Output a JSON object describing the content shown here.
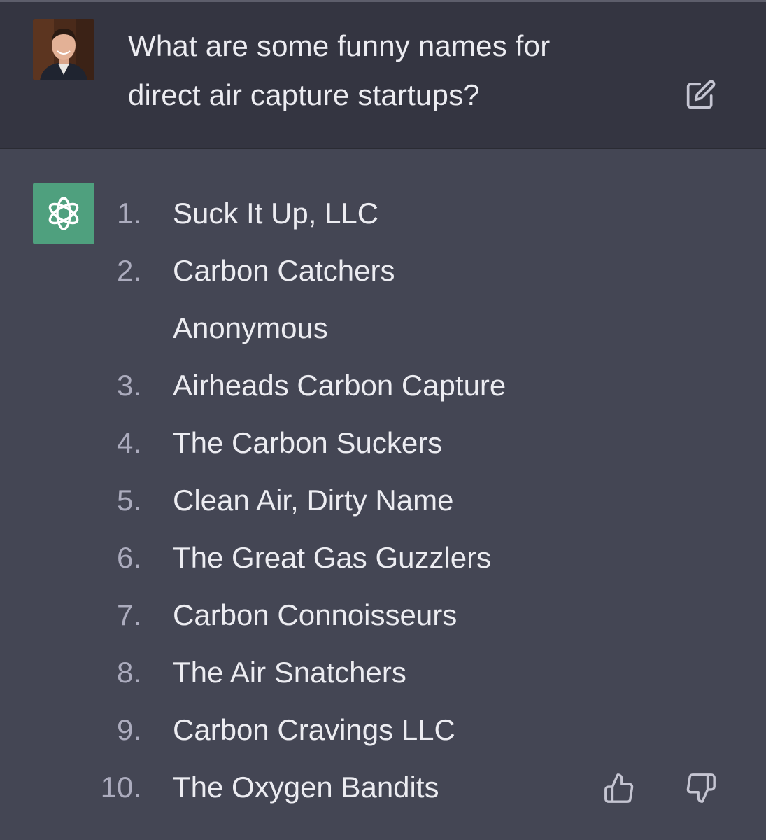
{
  "user_message": {
    "avatar_icon": "user-photo-avatar",
    "line1": "What are some funny names for",
    "line2": "direct air capture startups?",
    "edit_icon": "edit-icon"
  },
  "assistant_message": {
    "avatar_icon": "openai-logo-icon",
    "avatar_color": "#4fa07e",
    "items": [
      {
        "num": "1.",
        "text": "Suck It Up, LLC"
      },
      {
        "num": "2.",
        "text": "Carbon Catchers"
      },
      {
        "num": "",
        "text": "Anonymous"
      },
      {
        "num": "3.",
        "text": "Airheads Carbon Capture"
      },
      {
        "num": "4.",
        "text": "The Carbon Suckers"
      },
      {
        "num": "5.",
        "text": "Clean Air, Dirty Name"
      },
      {
        "num": "6.",
        "text": "The Great Gas Guzzlers"
      },
      {
        "num": "7.",
        "text": "Carbon Connoisseurs"
      },
      {
        "num": "8.",
        "text": "The Air Snatchers"
      },
      {
        "num": "9.",
        "text": "Carbon Cravings LLC"
      },
      {
        "num": "10.",
        "text": "The Oxygen Bandits"
      }
    ],
    "feedback_icons": [
      "thumbs-up-icon",
      "thumbs-down-icon"
    ]
  },
  "colors": {
    "user_bg": "#343541",
    "assistant_bg": "#444654",
    "text": "#ececf1",
    "number": "#acacbe"
  }
}
